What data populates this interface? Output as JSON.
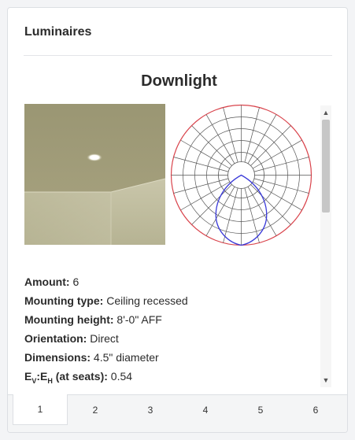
{
  "panel": {
    "title": "Luminaires"
  },
  "luminaire": {
    "name": "Downlight",
    "properties": [
      {
        "label": "Amount:",
        "value": "6"
      },
      {
        "label": "Mounting type:",
        "value": "Ceiling recessed"
      },
      {
        "label": "Mounting height:",
        "value": "8'-0\" AFF"
      },
      {
        "label": "Orientation:",
        "value": "Direct"
      },
      {
        "label": "Dimensions:",
        "value": "4.5\" diameter"
      }
    ],
    "ratio": {
      "label_main": "E",
      "sub1": "V",
      "colon": ":",
      "label_main2": "E",
      "sub2": "H",
      "label_rest": " (at seats):",
      "value": "0.54"
    }
  },
  "scrollbar": {
    "up": "▲",
    "down": "▼"
  },
  "tabs": [
    "1",
    "2",
    "3",
    "4",
    "5",
    "6"
  ],
  "colors": {
    "polar_outer": "#d9434b",
    "polar_curve": "#3a3ad8",
    "grid": "#555555",
    "render_bg": "#a39e7b"
  },
  "icons": {
    "render": "room-render-image",
    "polar": "polar-distribution-diagram"
  }
}
